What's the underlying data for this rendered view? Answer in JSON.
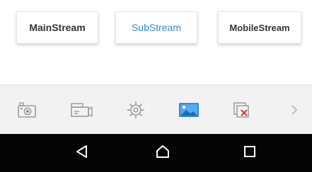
{
  "stream_selector": {
    "buttons": [
      {
        "label": "MainStream",
        "selected": false
      },
      {
        "label": "SubStream",
        "selected": true
      },
      {
        "label": "MobileStream",
        "selected": false
      }
    ]
  },
  "toolbar": {
    "items": [
      "snapshot-camera-icon",
      "record-video-icon",
      "settings-gear-icon",
      "image-quality-icon",
      "close-window-icon",
      "chevron-right-icon"
    ],
    "active_item": "image-quality-icon"
  },
  "android_nav": {
    "items": [
      "back-triangle-icon",
      "home-house-icon",
      "recents-square-icon"
    ]
  },
  "colors": {
    "accent": "#2e8bd8",
    "close_red": "#d9382b",
    "toolbar_bg": "#f2f2f2",
    "icon_gray": "#9a9a9a",
    "navbar_bg": "#050505"
  }
}
